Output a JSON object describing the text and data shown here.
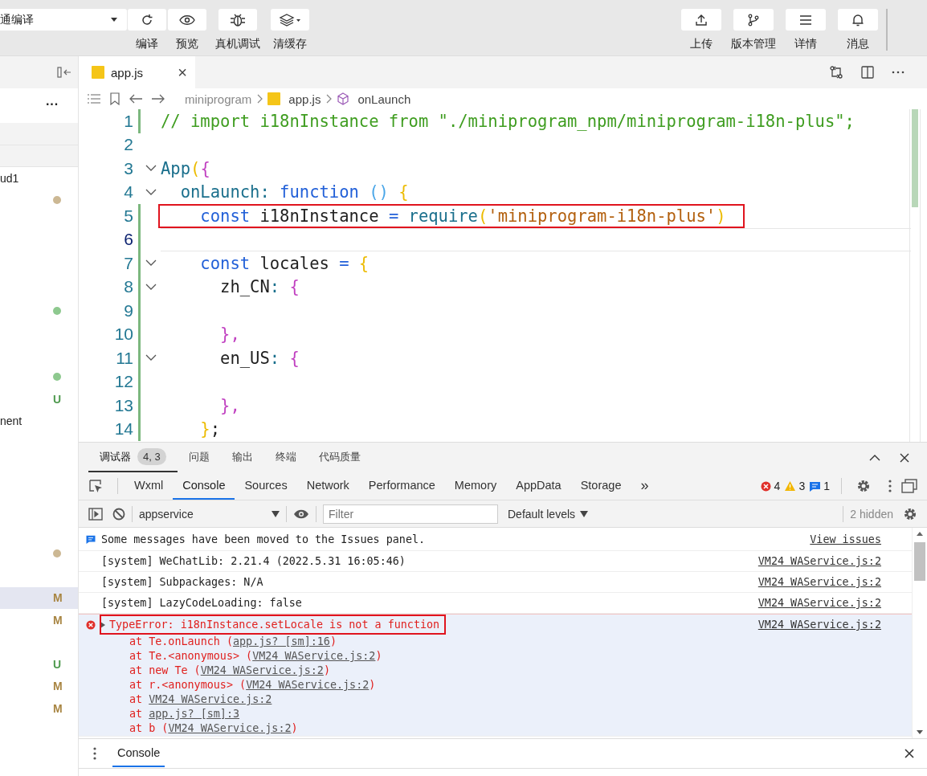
{
  "toolbar": {
    "mode_select": {
      "value": "通编译"
    },
    "left_buttons": [
      {
        "label": "编译",
        "kind": "refresh"
      },
      {
        "label": "预览",
        "kind": "eye"
      },
      {
        "label": "真机调试",
        "kind": "bug"
      },
      {
        "label": "清缓存",
        "kind": "layers"
      }
    ],
    "right_buttons": [
      {
        "label": "上传",
        "kind": "upload"
      },
      {
        "label": "版本管理",
        "kind": "branch"
      },
      {
        "label": "详情",
        "kind": "menu"
      },
      {
        "label": "消息",
        "kind": "bell"
      }
    ]
  },
  "sidebar": {
    "more": "···",
    "rows": [
      {
        "kind": "header",
        "selected": false
      },
      {
        "kind": "header",
        "selected": false
      },
      {
        "kind": "item",
        "selected": false,
        "label": "ud1"
      },
      {
        "kind": "item",
        "selected": false,
        "badge": {
          "kind": "dot",
          "color": "#ccb894"
        }
      },
      {
        "kind": "blank"
      },
      {
        "kind": "blank"
      },
      {
        "kind": "blank"
      },
      {
        "kind": "blank"
      },
      {
        "kind": "item",
        "selected": false,
        "badge": {
          "kind": "dot",
          "color": "#8ec98f"
        }
      },
      {
        "kind": "blank"
      },
      {
        "kind": "blank"
      },
      {
        "kind": "item",
        "selected": false,
        "badge": {
          "kind": "dot",
          "color": "#8ec98f"
        }
      },
      {
        "kind": "item",
        "selected": false,
        "badge": {
          "kind": "letter",
          "text": "U",
          "color": "#4f9a4f"
        }
      },
      {
        "kind": "item",
        "selected": false,
        "label": "nent"
      },
      {
        "kind": "blank"
      },
      {
        "kind": "blank"
      },
      {
        "kind": "blank"
      },
      {
        "kind": "blank"
      },
      {
        "kind": "blank"
      },
      {
        "kind": "item",
        "selected": false,
        "badge": {
          "kind": "dot",
          "color": "#ccb894"
        }
      },
      {
        "kind": "blank"
      },
      {
        "kind": "item",
        "selected": true,
        "badge": {
          "kind": "letter",
          "text": "M",
          "color": "#a88542"
        }
      },
      {
        "kind": "item",
        "selected": false,
        "badge": {
          "kind": "letter",
          "text": "M",
          "color": "#a88542"
        }
      },
      {
        "kind": "blank"
      },
      {
        "kind": "item",
        "selected": false,
        "badge": {
          "kind": "letter",
          "text": "U",
          "color": "#4f9a4f"
        }
      },
      {
        "kind": "item",
        "selected": false,
        "badge": {
          "kind": "letter",
          "text": "M",
          "color": "#a88542"
        }
      },
      {
        "kind": "item",
        "selected": false,
        "badge": {
          "kind": "letter",
          "text": "M",
          "color": "#a88542"
        }
      }
    ]
  },
  "editor": {
    "tabs": [
      {
        "label": "app.js",
        "selected": true,
        "close": "×"
      }
    ],
    "breadcrumb": [
      {
        "kind": "folder",
        "label": "miniprogram"
      },
      {
        "kind": "file",
        "label": "app.js"
      },
      {
        "kind": "symbol",
        "label": "onLaunch"
      }
    ],
    "lines": [
      {
        "number": "1",
        "changed": true,
        "foldable": false,
        "tokens": [
          {
            "t": "// import i18nInstance from \"./miniprogram_npm/miniprogram-i18n-plus\";",
            "kind": "comment"
          }
        ]
      },
      {
        "number": "2",
        "changed": false,
        "foldable": false
      },
      {
        "number": "3",
        "changed": false,
        "foldable": true,
        "tokens": [
          {
            "t": "App",
            "kind": "call"
          },
          {
            "t": "(",
            "kind": "b1"
          },
          {
            "t": "{",
            "kind": "b2"
          }
        ]
      },
      {
        "number": "4",
        "changed": false,
        "foldable": true,
        "tokens": [
          {
            "t": "  onLaunch",
            "kind": "call"
          },
          {
            "t": ": ",
            "kind": "call"
          },
          {
            "t": "function ",
            "kind": "keyword"
          },
          {
            "t": "() ",
            "kind": "b3"
          },
          {
            "t": "{",
            "kind": "b1"
          }
        ]
      },
      {
        "number": "5",
        "changed": true,
        "foldable": false,
        "highlighted": true,
        "tokens": [
          {
            "t": "    const ",
            "kind": "keyword"
          },
          {
            "t": "i18nInstance ",
            "kind": "ident"
          },
          {
            "t": "= ",
            "kind": "keyword"
          },
          {
            "t": "require",
            "kind": "call"
          },
          {
            "t": "(",
            "kind": "b1"
          },
          {
            "t": "'miniprogram-i18n-plus'",
            "kind": "string"
          },
          {
            "t": ")",
            "kind": "b1"
          }
        ]
      },
      {
        "number": "6",
        "changed": true,
        "foldable": false,
        "current": true
      },
      {
        "number": "7",
        "changed": true,
        "foldable": true,
        "tokens": [
          {
            "t": "    const ",
            "kind": "keyword"
          },
          {
            "t": "locales ",
            "kind": "ident"
          },
          {
            "t": "= ",
            "kind": "keyword"
          },
          {
            "t": "{",
            "kind": "b1"
          }
        ]
      },
      {
        "number": "8",
        "changed": true,
        "foldable": true,
        "tokens": [
          {
            "t": "      zh_CN",
            "kind": "ident"
          },
          {
            "t": ": ",
            "kind": "call"
          },
          {
            "t": "{",
            "kind": "b2"
          }
        ]
      },
      {
        "number": "9",
        "changed": true,
        "foldable": false
      },
      {
        "number": "10",
        "changed": true,
        "foldable": false,
        "tokens": [
          {
            "t": "      },",
            "kind": "b2"
          }
        ]
      },
      {
        "number": "11",
        "changed": true,
        "foldable": true,
        "tokens": [
          {
            "t": "      en_US",
            "kind": "ident"
          },
          {
            "t": ": ",
            "kind": "call"
          },
          {
            "t": "{",
            "kind": "b2"
          }
        ]
      },
      {
        "number": "12",
        "changed": true,
        "foldable": false
      },
      {
        "number": "13",
        "changed": true,
        "foldable": false,
        "tokens": [
          {
            "t": "      },",
            "kind": "b2"
          }
        ]
      },
      {
        "number": "14",
        "changed": true,
        "foldable": false,
        "tokens": [
          {
            "t": "    }",
            "kind": "b1"
          },
          {
            "t": ";",
            "kind": "ident"
          }
        ]
      }
    ]
  },
  "devtools": {
    "panel_tabs": [
      {
        "label": "调试器",
        "selected": true,
        "badge": "4, 3"
      },
      {
        "label": "问题",
        "selected": false
      },
      {
        "label": "输出",
        "selected": false
      },
      {
        "label": "终端",
        "selected": false
      },
      {
        "label": "代码质量",
        "selected": false
      }
    ],
    "tabs": [
      {
        "label": "Wxml",
        "selected": false
      },
      {
        "label": "Console",
        "selected": true
      },
      {
        "label": "Sources",
        "selected": false
      },
      {
        "label": "Network",
        "selected": false
      },
      {
        "label": "Performance",
        "selected": false
      },
      {
        "label": "Memory",
        "selected": false
      },
      {
        "label": "AppData",
        "selected": false
      },
      {
        "label": "Storage",
        "selected": false
      }
    ],
    "more_tabs": "»",
    "counts": {
      "errors": "4",
      "warnings": "3",
      "infos": "1"
    },
    "console_toolbar": {
      "context": "appservice",
      "filter_placeholder": "Filter",
      "levels": "Default levels",
      "hidden": "2 hidden"
    },
    "messages": [
      {
        "kind": "info",
        "text": "Some messages have been moved to the Issues panel.",
        "link": "View issues"
      },
      {
        "kind": "log",
        "text": "[system] WeChatLib: 2.21.4 (2022.5.31 16:05:46)",
        "source": "VM24 WAService.js:2"
      },
      {
        "kind": "log",
        "text": "[system] Subpackages: N/A",
        "source": "VM24 WAService.js:2"
      },
      {
        "kind": "log",
        "text": "[system] LazyCodeLoading: false",
        "source": "VM24 WAService.js:2"
      },
      {
        "kind": "error",
        "text": "TypeError: i18nInstance.setLocale is not a function",
        "source": "VM24 WAService.js:2",
        "expanded": true,
        "highlighted": true,
        "stack": [
          {
            "prefix": "at Te.onLaunch (",
            "link": "app.js? [sm]:16",
            "suffix": ")"
          },
          {
            "prefix": "at Te.<anonymous> (",
            "link": "VM24 WAService.js:2",
            "suffix": ")"
          },
          {
            "prefix": "at new Te (",
            "link": "VM24 WAService.js:2",
            "suffix": ")"
          },
          {
            "prefix": "at r.<anonymous> (",
            "link": "VM24 WAService.js:2",
            "suffix": ")"
          },
          {
            "prefix": "at ",
            "link": "VM24 WAService.js:2"
          },
          {
            "prefix": "at ",
            "link": "app.js? [sm]:3"
          },
          {
            "prefix": "at b (",
            "link": "VM24 WAService.js:2",
            "suffix": ")"
          }
        ]
      }
    ],
    "drawer": {
      "tabs": [
        {
          "label": "Console",
          "selected": true
        }
      ]
    }
  }
}
